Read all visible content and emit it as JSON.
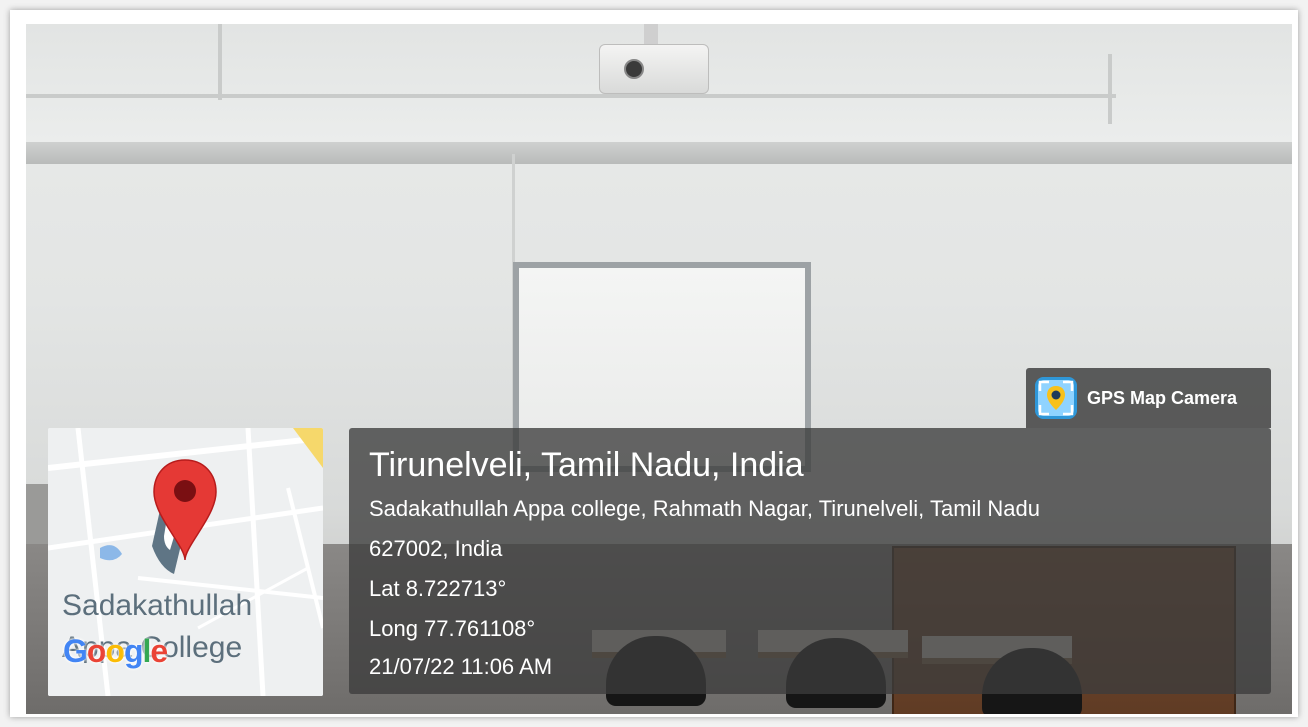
{
  "badge": {
    "label": "GPS Map Camera",
    "icon": "gps-camera-app-icon"
  },
  "map": {
    "place_label_line1": "Sadakathullah",
    "place_label_line2": "Appa College",
    "logo_text": "Google",
    "pin_color": "#e53935"
  },
  "location": {
    "title": "Tirunelveli, Tamil Nadu, India",
    "address_line1": "Sadakathullah Appa college, Rahmath Nagar, Tirunelveli, Tamil Nadu",
    "address_line2": "627002, India",
    "latitude": "Lat 8.722713°",
    "longitude": "Long 77.761108°",
    "datetime": "21/07/22 11:06 AM"
  }
}
